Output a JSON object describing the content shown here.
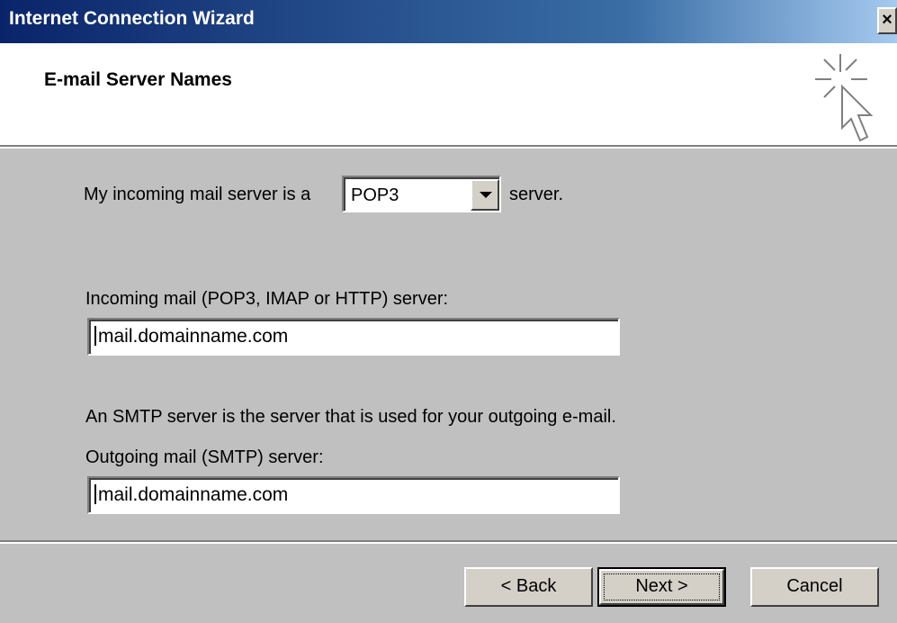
{
  "window": {
    "title": "Internet Connection Wizard",
    "close_label": "×"
  },
  "header": {
    "title": "E-mail Server Names",
    "icon": "wizard-cursor-sparkle-icon"
  },
  "form": {
    "incoming_type_prefix": "My incoming mail server is a",
    "incoming_type_value": "POP3",
    "incoming_type_suffix": "server.",
    "incoming_label": "Incoming mail (POP3, IMAP or HTTP) server:",
    "incoming_value": "mail.domainname.com",
    "smtp_description": "An SMTP server is the server that is used for your outgoing e-mail.",
    "outgoing_label": "Outgoing mail (SMTP) server:",
    "outgoing_value": "mail.domainname.com"
  },
  "buttons": {
    "back": "< Back",
    "next": "Next >",
    "cancel": "Cancel"
  },
  "colors": {
    "title_gradient_start": "#0a246a",
    "title_gradient_end": "#a6caf0",
    "dialog_face": "#c0c0c0",
    "header_bg": "#ffffff"
  }
}
